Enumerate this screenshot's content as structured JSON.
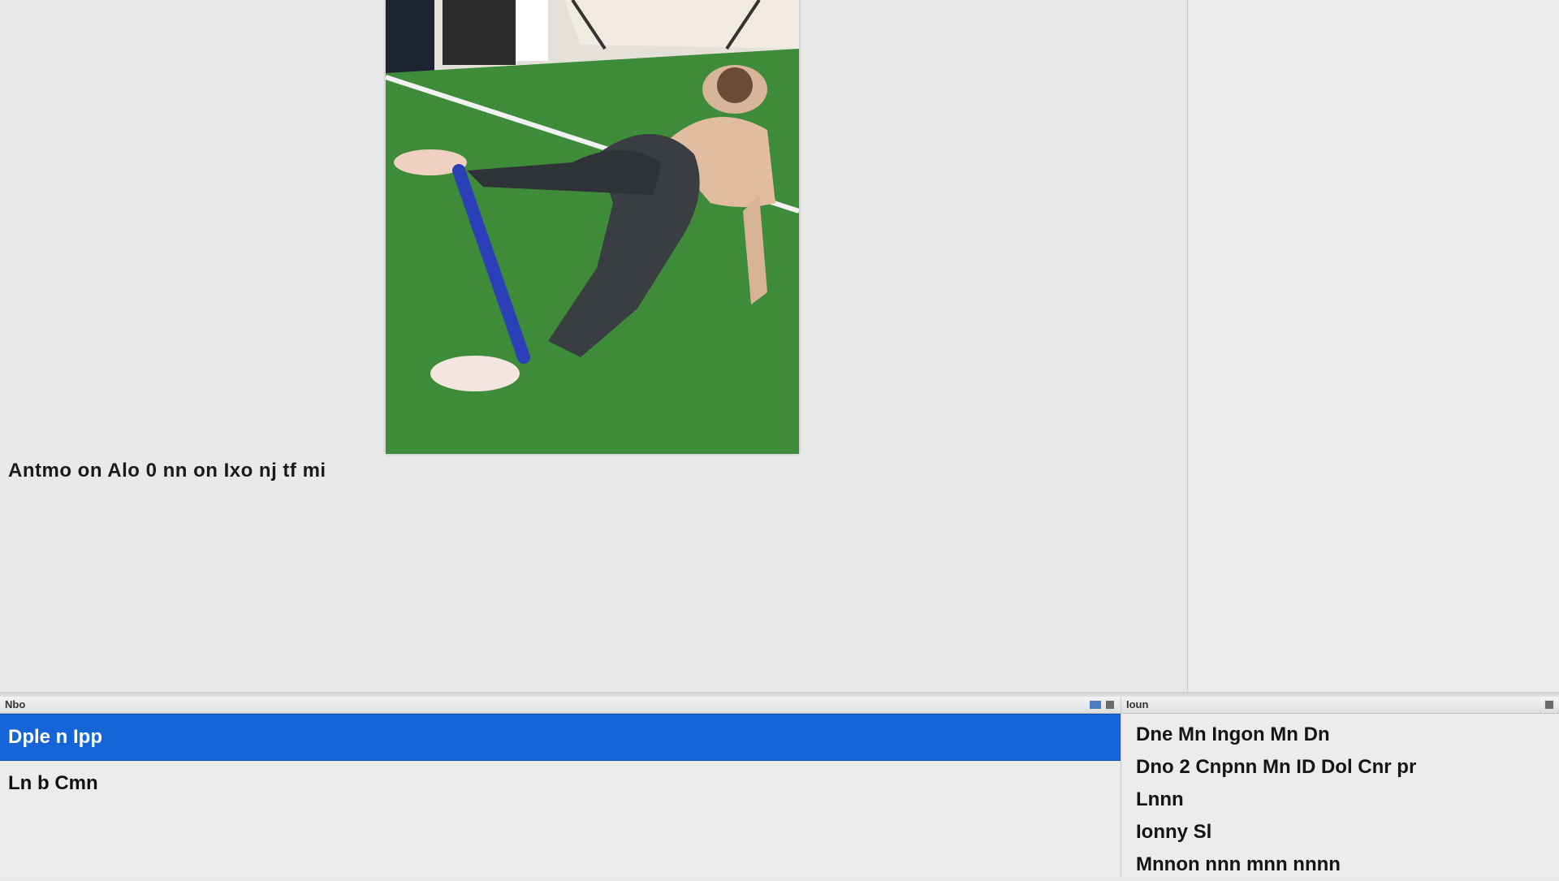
{
  "document": {
    "image_alt": "Exercise photo: person on all fours on green turf with a blue resistance band around one foot",
    "caption": "Antmo on Alo 0 nn on Ixo nj tf mi"
  },
  "bottom_left_pane": {
    "header": "Nbo",
    "items": [
      {
        "label": "Dple n Ipp",
        "selected": true
      },
      {
        "label": "Ln b Cmn",
        "selected": false
      }
    ]
  },
  "bottom_right_pane": {
    "header": "Ioun",
    "lines": [
      "Dne Mn Ingon Mn Dn",
      "Dno 2 Cnpnn Mn ID Dol Cnr pr",
      "Lnnn",
      "Ionny Sl",
      "Mnnon nnn mnn nnnn"
    ]
  },
  "colors": {
    "selection": "#1565d8",
    "turf": "#3d8a3a",
    "band": "#2a3fb8"
  }
}
